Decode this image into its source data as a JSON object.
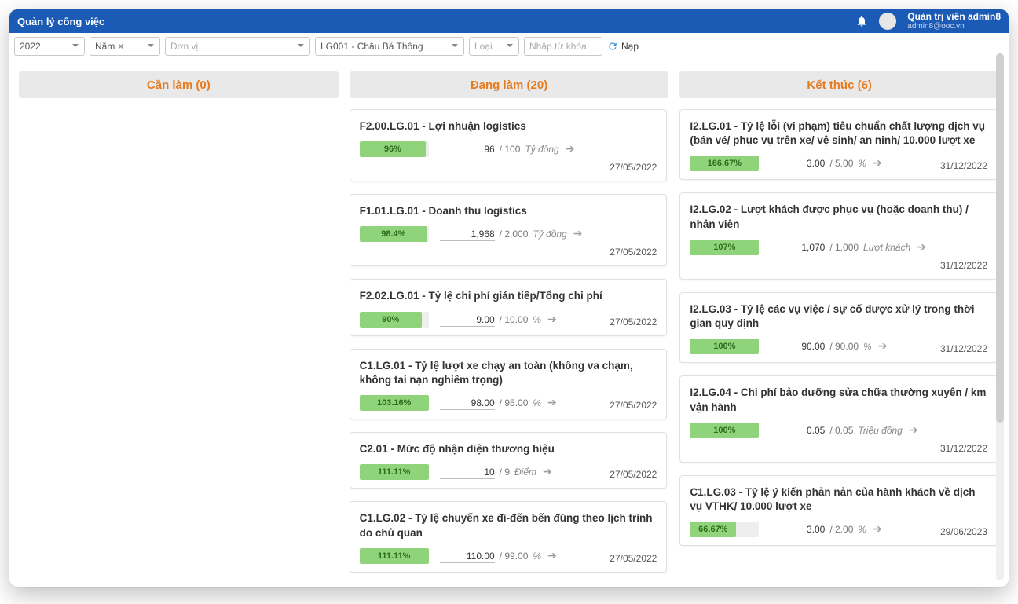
{
  "header": {
    "title": "Quản lý công việc",
    "user_name": "Quản trị viên admin8",
    "user_email": "admin8@ooc.vn"
  },
  "toolbar": {
    "year": "2022",
    "period": "Năm",
    "org_unit_placeholder": "Đơn vị",
    "employee": "LG001 - Châu Bá Thông",
    "type_placeholder": "Loại",
    "search_placeholder": "Nhập từ khóa",
    "reload_label": "Nạp"
  },
  "columns": {
    "todo": {
      "title": "Cần làm (0)"
    },
    "doing": {
      "title": "Đang làm (20)"
    },
    "done": {
      "title": "Kết thúc (6)"
    }
  },
  "doing": [
    {
      "title": "F2.00.LG.01 - Lợi nhuận logistics",
      "percent": "96%",
      "pwidth": 96,
      "current": "96",
      "target": "100",
      "unit": "Tỷ đồng",
      "date": "27/05/2022",
      "date_below": true
    },
    {
      "title": "F1.01.LG.01 - Doanh thu logistics",
      "percent": "98.4%",
      "pwidth": 98,
      "current": "1,968",
      "target": "2,000",
      "unit": "Tỷ đồng",
      "date": "27/05/2022",
      "date_below": true
    },
    {
      "title": "F2.02.LG.01 - Tỷ lệ chi phí gián tiếp/Tổng chi phí",
      "percent": "90%",
      "pwidth": 90,
      "current": "9.00",
      "target": "10.00",
      "unit": "%",
      "date": "27/05/2022",
      "date_below": false
    },
    {
      "title": "C1.LG.01 - Tỷ lệ lượt xe chạy an toàn (không va chạm, không tai nạn nghiêm trọng)",
      "percent": "103.16%",
      "pwidth": 100,
      "current": "98.00",
      "target": "95.00",
      "unit": "%",
      "date": "27/05/2022",
      "date_below": false
    },
    {
      "title": "C2.01 - Mức độ nhận diện thương hiệu",
      "percent": "111.11%",
      "pwidth": 100,
      "current": "10",
      "target": "9",
      "unit": "Điểm",
      "date": "27/05/2022",
      "date_below": false
    },
    {
      "title": "C1.LG.02 - Tỷ lệ chuyến xe đi-đến bến đúng theo lịch trình do chủ quan",
      "percent": "111.11%",
      "pwidth": 100,
      "current": "110.00",
      "target": "99.00",
      "unit": "%",
      "date": "27/05/2022",
      "date_below": false
    }
  ],
  "done": [
    {
      "title": "I2.LG.01 - Tỷ lệ lỗi (vi phạm) tiêu chuẩn chất lượng dịch vụ (bán vé/ phục vụ trên xe/ vệ sinh/ an ninh/ 10.000 lượt xe",
      "percent": "166.67%",
      "pwidth": 100,
      "current": "3.00",
      "target": "5.00",
      "unit": "%",
      "date": "31/12/2022",
      "date_below": false
    },
    {
      "title": "I2.LG.02 - Lượt khách được phục vụ (hoặc doanh thu) / nhân viên",
      "percent": "107%",
      "pwidth": 100,
      "current": "1,070",
      "target": "1,000",
      "unit": "Lượt khách",
      "date": "31/12/2022",
      "date_below": true
    },
    {
      "title": "I2.LG.03 - Tỷ lệ các vụ việc / sự cố được xử lý trong thời gian quy định",
      "percent": "100%",
      "pwidth": 100,
      "current": "90.00",
      "target": "90.00",
      "unit": "%",
      "date": "31/12/2022",
      "date_below": false
    },
    {
      "title": "I2.LG.04 - Chi phí bảo dưỡng sửa chữa thường xuyên / km vận hành",
      "percent": "100%",
      "pwidth": 100,
      "current": "0.05",
      "target": "0.05",
      "unit": "Triệu đồng",
      "date": "31/12/2022",
      "date_below": true
    },
    {
      "title": "C1.LG.03 - Tỷ lệ ý kiến phản nản của hành khách về dịch vụ VTHK/ 10.000 lượt xe",
      "percent": "66.67%",
      "pwidth": 67,
      "current": "3.00",
      "target": "2.00",
      "unit": "%",
      "date": "29/06/2023",
      "date_below": false
    }
  ]
}
